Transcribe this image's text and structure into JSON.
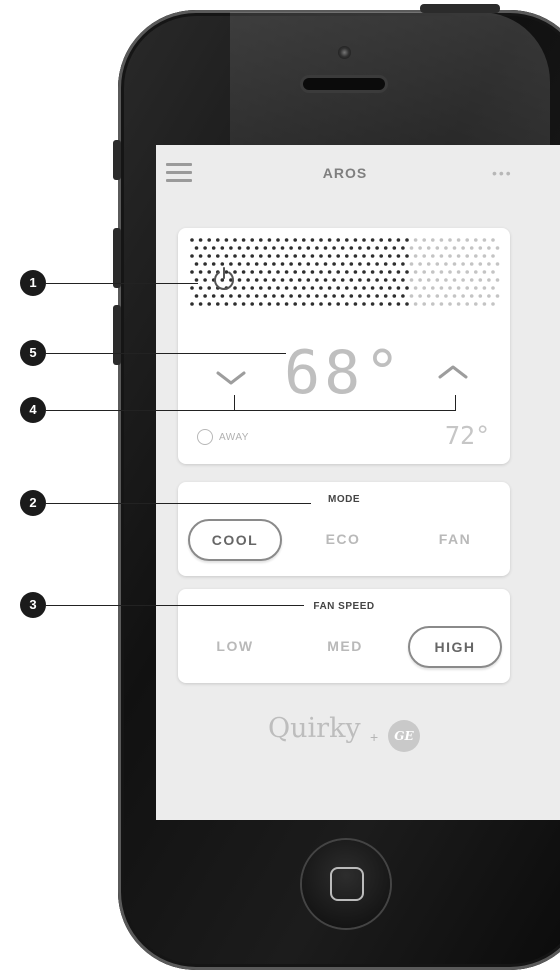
{
  "app": {
    "title": "AROS"
  },
  "thermostat": {
    "set_temp": "68°",
    "outdoor_temp": "72°",
    "away_label": "AWAY"
  },
  "mode": {
    "heading": "MODE",
    "options": [
      "COOL",
      "ECO",
      "FAN"
    ],
    "selected": "COOL"
  },
  "fan_speed": {
    "heading": "FAN SPEED",
    "options": [
      "LOW",
      "MED",
      "HIGH"
    ],
    "selected": "HIGH"
  },
  "callouts": [
    "1",
    "2",
    "3",
    "4",
    "5"
  ],
  "branding": {
    "quirky": "Quirky",
    "plus": "+",
    "ge": "GE"
  },
  "icons": [
    "menu-icon",
    "more-icon",
    "power-icon",
    "chevron-down-icon",
    "chevron-up-icon",
    "clock-icon",
    "home-square-icon"
  ],
  "colors": {
    "screen_bg": "#ececec",
    "card_bg": "#ffffff",
    "inactive_text": "#b9b9b9",
    "active_text": "#666666",
    "badge": "#1b1b1b"
  }
}
